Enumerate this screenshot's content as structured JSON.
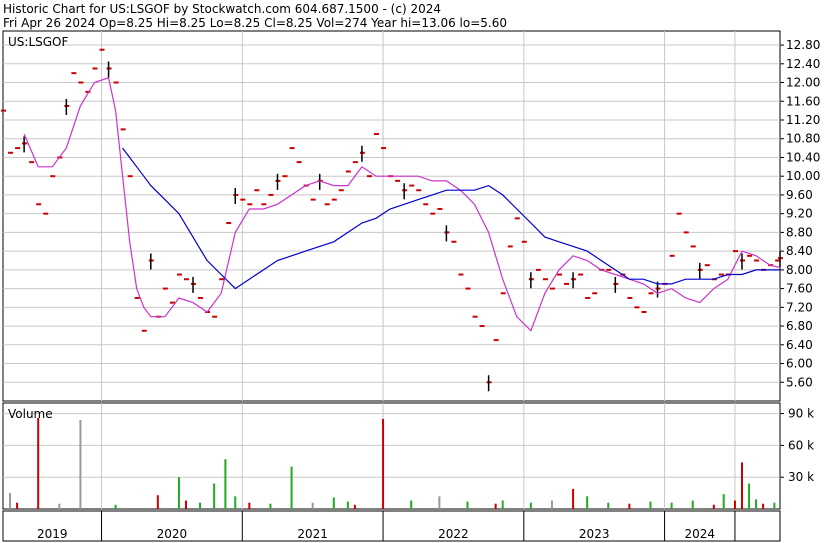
{
  "header": {
    "line1": "Historic Chart for US:LSGOF by Stockwatch.com 604.687.1500 - (c) 2024",
    "line2": "Fri Apr 26 2024  Op=8.25  Hi=8.25  Lo=8.25  Cl=8.25  Vol=274  Year hi=13.06  lo=5.60"
  },
  "colors": {
    "price": "#cc0000",
    "up_bar": "#000000",
    "ma_short": "#cc33cc",
    "ma_long": "#0000cc",
    "grid": "#c8c8c8",
    "vol_up": "#22aa22",
    "vol_down": "#cc0000",
    "vol_neutral": "#999999"
  },
  "chart_data": {
    "type": "line",
    "symbol_label": "US:LSGOF",
    "volume_label": "Volume",
    "x_axis": {
      "range": [
        "2018-10",
        "2024-04-26"
      ],
      "labels": [
        "2019",
        "2020",
        "2021",
        "2022",
        "2023",
        "2024"
      ]
    },
    "price_axis": {
      "ylim": [
        5.2,
        13.1
      ],
      "ticks": [
        "12.80",
        "12.40",
        "12.00",
        "11.60",
        "11.20",
        "10.80",
        "10.40",
        "10.00",
        "9.60",
        "9.20",
        "8.80",
        "8.40",
        "8.00",
        "7.60",
        "7.20",
        "6.80",
        "6.40",
        "6.00",
        "5.60"
      ]
    },
    "volume_axis": {
      "ylim": [
        0,
        100
      ],
      "ticks": [
        "90 k",
        "60 k",
        "30 k"
      ]
    },
    "series": [
      {
        "key": "price",
        "x": [
          2018.8,
          2018.85,
          2018.9,
          2018.95,
          2019.0,
          2019.05,
          2019.1,
          2019.15,
          2019.2,
          2019.25,
          2019.3,
          2019.35,
          2019.4,
          2019.45,
          2019.5,
          2019.55,
          2019.6,
          2019.65,
          2019.7,
          2019.75,
          2019.8,
          2019.85,
          2019.9,
          2019.95,
          2020.0,
          2020.05,
          2020.1,
          2020.15,
          2020.2,
          2020.25,
          2020.3,
          2020.35,
          2020.4,
          2020.45,
          2020.5,
          2020.55,
          2020.6,
          2020.65,
          2020.7,
          2020.75,
          2020.8,
          2020.85,
          2020.9,
          2020.95,
          2021.0,
          2021.05,
          2021.1,
          2021.15,
          2021.2,
          2021.25,
          2021.3,
          2021.35,
          2021.4,
          2021.45,
          2021.5,
          2021.55,
          2021.6,
          2021.65,
          2021.7,
          2021.75,
          2021.8,
          2021.85,
          2021.9,
          2021.95,
          2022.0,
          2022.05,
          2022.1,
          2022.15,
          2022.2,
          2022.25,
          2022.3,
          2022.35,
          2022.4,
          2022.45,
          2022.5,
          2022.55,
          2022.6,
          2022.65,
          2022.7,
          2022.75,
          2022.8,
          2022.85,
          2022.9,
          2022.95,
          2023.0,
          2023.05,
          2023.1,
          2023.15,
          2023.2,
          2023.25,
          2023.3,
          2023.35,
          2023.4,
          2023.45,
          2023.5,
          2023.55,
          2023.6,
          2023.65,
          2023.7,
          2023.75,
          2023.8,
          2023.85,
          2023.9,
          2023.95,
          2024.0,
          2024.05,
          2024.1,
          2024.15,
          2024.2,
          2024.25,
          2024.3,
          2024.32
        ],
        "values": [
          11.4,
          10.5,
          10.6,
          10.7,
          10.3,
          9.4,
          9.2,
          10.0,
          10.4,
          11.5,
          12.2,
          12.0,
          11.8,
          12.3,
          12.7,
          12.3,
          12.0,
          11.0,
          10.0,
          7.4,
          6.7,
          8.2,
          7.0,
          7.6,
          7.3,
          7.9,
          7.8,
          7.7,
          7.4,
          7.1,
          7.0,
          7.8,
          9.0,
          9.6,
          9.5,
          9.4,
          9.7,
          9.4,
          9.6,
          9.9,
          10.0,
          10.6,
          10.3,
          9.8,
          9.5,
          9.9,
          9.4,
          9.5,
          9.7,
          10.1,
          10.3,
          10.5,
          10.0,
          10.9,
          10.6,
          10.0,
          9.9,
          9.7,
          9.8,
          9.7,
          9.4,
          9.2,
          9.3,
          8.8,
          8.6,
          7.9,
          7.6,
          7.0,
          6.8,
          5.6,
          6.5,
          7.5,
          8.5,
          9.1,
          8.6,
          7.8,
          8.0,
          7.8,
          7.6,
          7.9,
          7.7,
          7.8,
          7.9,
          7.4,
          7.5,
          8.0,
          8.0,
          7.7,
          7.9,
          7.4,
          7.2,
          7.1,
          7.5,
          7.6,
          7.7,
          8.3,
          9.2,
          8.8,
          8.5,
          8.0,
          8.1,
          7.8,
          7.9,
          7.9,
          8.4,
          8.2,
          8.3,
          8.2,
          8.0,
          8.1,
          8.2,
          8.25
        ]
      },
      {
        "key": "ma_short",
        "x": [
          2018.95,
          2019.05,
          2019.15,
          2019.25,
          2019.35,
          2019.45,
          2019.55,
          2019.6,
          2019.65,
          2019.7,
          2019.75,
          2019.8,
          2019.85,
          2019.95,
          2020.05,
          2020.15,
          2020.25,
          2020.35,
          2020.45,
          2020.55,
          2020.65,
          2020.75,
          2020.85,
          2020.95,
          2021.05,
          2021.15,
          2021.25,
          2021.35,
          2021.45,
          2021.55,
          2021.65,
          2021.75,
          2021.85,
          2021.95,
          2022.05,
          2022.15,
          2022.25,
          2022.35,
          2022.45,
          2022.55,
          2022.65,
          2022.75,
          2022.85,
          2022.95,
          2023.05,
          2023.15,
          2023.25,
          2023.35,
          2023.45,
          2023.55,
          2023.65,
          2023.75,
          2023.85,
          2023.95,
          2024.05,
          2024.15,
          2024.25,
          2024.32
        ],
        "values": [
          10.9,
          10.2,
          10.2,
          10.6,
          11.5,
          12.0,
          12.1,
          11.4,
          10.0,
          8.6,
          7.6,
          7.2,
          7.0,
          7.0,
          7.4,
          7.3,
          7.1,
          7.5,
          8.8,
          9.3,
          9.3,
          9.4,
          9.6,
          9.8,
          9.9,
          9.8,
          9.8,
          10.2,
          10.0,
          10.0,
          10.0,
          10.0,
          9.9,
          9.9,
          9.7,
          9.4,
          8.8,
          7.8,
          7.0,
          6.7,
          7.5,
          8.0,
          8.3,
          8.2,
          8.0,
          7.9,
          7.8,
          7.7,
          7.5,
          7.6,
          7.4,
          7.3,
          7.6,
          7.8,
          8.4,
          8.3,
          8.1,
          8.05
        ]
      },
      {
        "key": "ma_long",
        "x": [
          2019.65,
          2019.7,
          2019.75,
          2019.8,
          2019.85,
          2019.95,
          2020.05,
          2020.15,
          2020.25,
          2020.35,
          2020.45,
          2020.55,
          2020.65,
          2020.75,
          2020.85,
          2020.95,
          2021.05,
          2021.15,
          2021.25,
          2021.35,
          2021.45,
          2021.55,
          2021.65,
          2021.75,
          2021.85,
          2021.95,
          2022.05,
          2022.15,
          2022.25,
          2022.35,
          2022.45,
          2022.55,
          2022.65,
          2022.75,
          2022.85,
          2022.95,
          2023.05,
          2023.15,
          2023.25,
          2023.35,
          2023.45,
          2023.55,
          2023.65,
          2023.75,
          2023.85,
          2023.95,
          2024.05,
          2024.15,
          2024.25,
          2024.32
        ],
        "values": [
          10.6,
          10.4,
          10.2,
          10.0,
          9.8,
          9.5,
          9.2,
          8.7,
          8.2,
          7.9,
          7.6,
          7.8,
          8.0,
          8.2,
          8.3,
          8.4,
          8.5,
          8.6,
          8.8,
          9.0,
          9.1,
          9.3,
          9.4,
          9.5,
          9.6,
          9.7,
          9.7,
          9.7,
          9.8,
          9.6,
          9.3,
          9.0,
          8.7,
          8.6,
          8.5,
          8.4,
          8.2,
          8.0,
          7.8,
          7.8,
          7.7,
          7.7,
          7.8,
          7.8,
          7.8,
          7.9,
          7.9,
          8.0,
          8.0,
          8.0
        ]
      },
      {
        "key": "volume",
        "x": [
          2018.85,
          2018.9,
          2019.05,
          2019.2,
          2019.35,
          2019.6,
          2019.9,
          2020.05,
          2020.1,
          2020.2,
          2020.3,
          2020.38,
          2020.45,
          2020.55,
          2020.7,
          2020.85,
          2021.0,
          2021.15,
          2021.25,
          2021.3,
          2021.5,
          2021.7,
          2021.9,
          2022.1,
          2022.3,
          2022.35,
          2022.55,
          2022.7,
          2022.85,
          2022.95,
          2023.1,
          2023.25,
          2023.4,
          2023.55,
          2023.7,
          2023.85,
          2023.92,
          2024.0,
          2024.05,
          2024.1,
          2024.15,
          2024.2,
          2024.28
        ],
        "values": [
          15,
          6,
          86,
          5,
          84,
          4,
          13,
          30,
          8,
          6,
          24,
          47,
          12,
          6,
          5,
          40,
          6,
          11,
          7,
          4,
          85,
          8,
          12,
          7,
          5,
          8,
          6,
          8,
          19,
          12,
          6,
          5,
          7,
          6,
          8,
          4,
          14,
          8,
          44,
          24,
          9,
          5,
          6
        ],
        "colors": [
          "vol_neutral",
          "vol_down",
          "vol_down",
          "vol_neutral",
          "vol_neutral",
          "vol_up",
          "vol_down",
          "vol_up",
          "vol_down",
          "vol_up",
          "vol_up",
          "vol_up",
          "vol_up",
          "vol_down",
          "vol_up",
          "vol_up",
          "vol_neutral",
          "vol_up",
          "vol_up",
          "vol_down",
          "vol_down",
          "vol_up",
          "vol_neutral",
          "vol_up",
          "vol_down",
          "vol_up",
          "vol_up",
          "vol_neutral",
          "vol_down",
          "vol_up",
          "vol_up",
          "vol_down",
          "vol_up",
          "vol_up",
          "vol_up",
          "vol_down",
          "vol_up",
          "vol_down",
          "vol_down",
          "vol_up",
          "vol_up",
          "vol_down",
          "vol_up"
        ]
      }
    ],
    "grid": true,
    "legend": "none"
  }
}
